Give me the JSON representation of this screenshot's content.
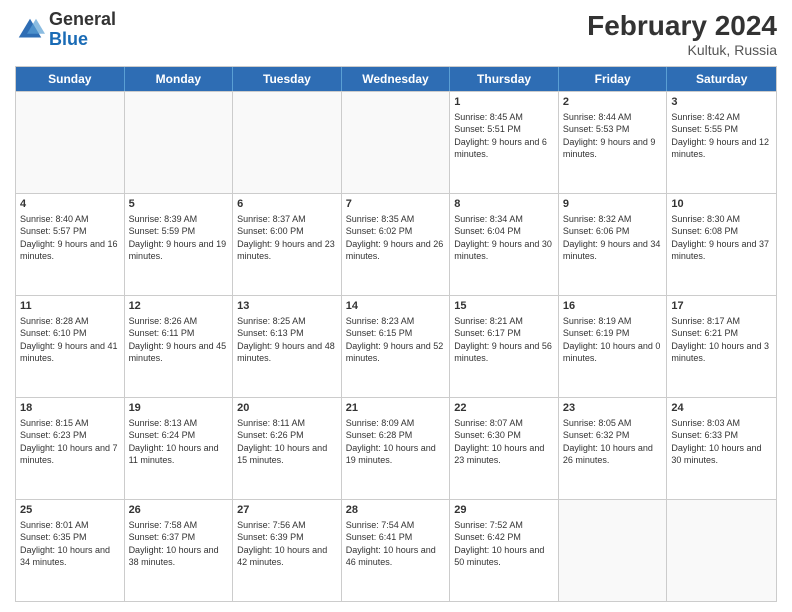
{
  "header": {
    "logo_general": "General",
    "logo_blue": "Blue",
    "month_year": "February 2024",
    "location": "Kultuk, Russia"
  },
  "days_of_week": [
    "Sunday",
    "Monday",
    "Tuesday",
    "Wednesday",
    "Thursday",
    "Friday",
    "Saturday"
  ],
  "rows": [
    [
      {
        "day": "",
        "text": ""
      },
      {
        "day": "",
        "text": ""
      },
      {
        "day": "",
        "text": ""
      },
      {
        "day": "",
        "text": ""
      },
      {
        "day": "1",
        "text": "Sunrise: 8:45 AM\nSunset: 5:51 PM\nDaylight: 9 hours and 6 minutes."
      },
      {
        "day": "2",
        "text": "Sunrise: 8:44 AM\nSunset: 5:53 PM\nDaylight: 9 hours and 9 minutes."
      },
      {
        "day": "3",
        "text": "Sunrise: 8:42 AM\nSunset: 5:55 PM\nDaylight: 9 hours and 12 minutes."
      }
    ],
    [
      {
        "day": "4",
        "text": "Sunrise: 8:40 AM\nSunset: 5:57 PM\nDaylight: 9 hours and 16 minutes."
      },
      {
        "day": "5",
        "text": "Sunrise: 8:39 AM\nSunset: 5:59 PM\nDaylight: 9 hours and 19 minutes."
      },
      {
        "day": "6",
        "text": "Sunrise: 8:37 AM\nSunset: 6:00 PM\nDaylight: 9 hours and 23 minutes."
      },
      {
        "day": "7",
        "text": "Sunrise: 8:35 AM\nSunset: 6:02 PM\nDaylight: 9 hours and 26 minutes."
      },
      {
        "day": "8",
        "text": "Sunrise: 8:34 AM\nSunset: 6:04 PM\nDaylight: 9 hours and 30 minutes."
      },
      {
        "day": "9",
        "text": "Sunrise: 8:32 AM\nSunset: 6:06 PM\nDaylight: 9 hours and 34 minutes."
      },
      {
        "day": "10",
        "text": "Sunrise: 8:30 AM\nSunset: 6:08 PM\nDaylight: 9 hours and 37 minutes."
      }
    ],
    [
      {
        "day": "11",
        "text": "Sunrise: 8:28 AM\nSunset: 6:10 PM\nDaylight: 9 hours and 41 minutes."
      },
      {
        "day": "12",
        "text": "Sunrise: 8:26 AM\nSunset: 6:11 PM\nDaylight: 9 hours and 45 minutes."
      },
      {
        "day": "13",
        "text": "Sunrise: 8:25 AM\nSunset: 6:13 PM\nDaylight: 9 hours and 48 minutes."
      },
      {
        "day": "14",
        "text": "Sunrise: 8:23 AM\nSunset: 6:15 PM\nDaylight: 9 hours and 52 minutes."
      },
      {
        "day": "15",
        "text": "Sunrise: 8:21 AM\nSunset: 6:17 PM\nDaylight: 9 hours and 56 minutes."
      },
      {
        "day": "16",
        "text": "Sunrise: 8:19 AM\nSunset: 6:19 PM\nDaylight: 10 hours and 0 minutes."
      },
      {
        "day": "17",
        "text": "Sunrise: 8:17 AM\nSunset: 6:21 PM\nDaylight: 10 hours and 3 minutes."
      }
    ],
    [
      {
        "day": "18",
        "text": "Sunrise: 8:15 AM\nSunset: 6:23 PM\nDaylight: 10 hours and 7 minutes."
      },
      {
        "day": "19",
        "text": "Sunrise: 8:13 AM\nSunset: 6:24 PM\nDaylight: 10 hours and 11 minutes."
      },
      {
        "day": "20",
        "text": "Sunrise: 8:11 AM\nSunset: 6:26 PM\nDaylight: 10 hours and 15 minutes."
      },
      {
        "day": "21",
        "text": "Sunrise: 8:09 AM\nSunset: 6:28 PM\nDaylight: 10 hours and 19 minutes."
      },
      {
        "day": "22",
        "text": "Sunrise: 8:07 AM\nSunset: 6:30 PM\nDaylight: 10 hours and 23 minutes."
      },
      {
        "day": "23",
        "text": "Sunrise: 8:05 AM\nSunset: 6:32 PM\nDaylight: 10 hours and 26 minutes."
      },
      {
        "day": "24",
        "text": "Sunrise: 8:03 AM\nSunset: 6:33 PM\nDaylight: 10 hours and 30 minutes."
      }
    ],
    [
      {
        "day": "25",
        "text": "Sunrise: 8:01 AM\nSunset: 6:35 PM\nDaylight: 10 hours and 34 minutes."
      },
      {
        "day": "26",
        "text": "Sunrise: 7:58 AM\nSunset: 6:37 PM\nDaylight: 10 hours and 38 minutes."
      },
      {
        "day": "27",
        "text": "Sunrise: 7:56 AM\nSunset: 6:39 PM\nDaylight: 10 hours and 42 minutes."
      },
      {
        "day": "28",
        "text": "Sunrise: 7:54 AM\nSunset: 6:41 PM\nDaylight: 10 hours and 46 minutes."
      },
      {
        "day": "29",
        "text": "Sunrise: 7:52 AM\nSunset: 6:42 PM\nDaylight: 10 hours and 50 minutes."
      },
      {
        "day": "",
        "text": ""
      },
      {
        "day": "",
        "text": ""
      }
    ]
  ]
}
